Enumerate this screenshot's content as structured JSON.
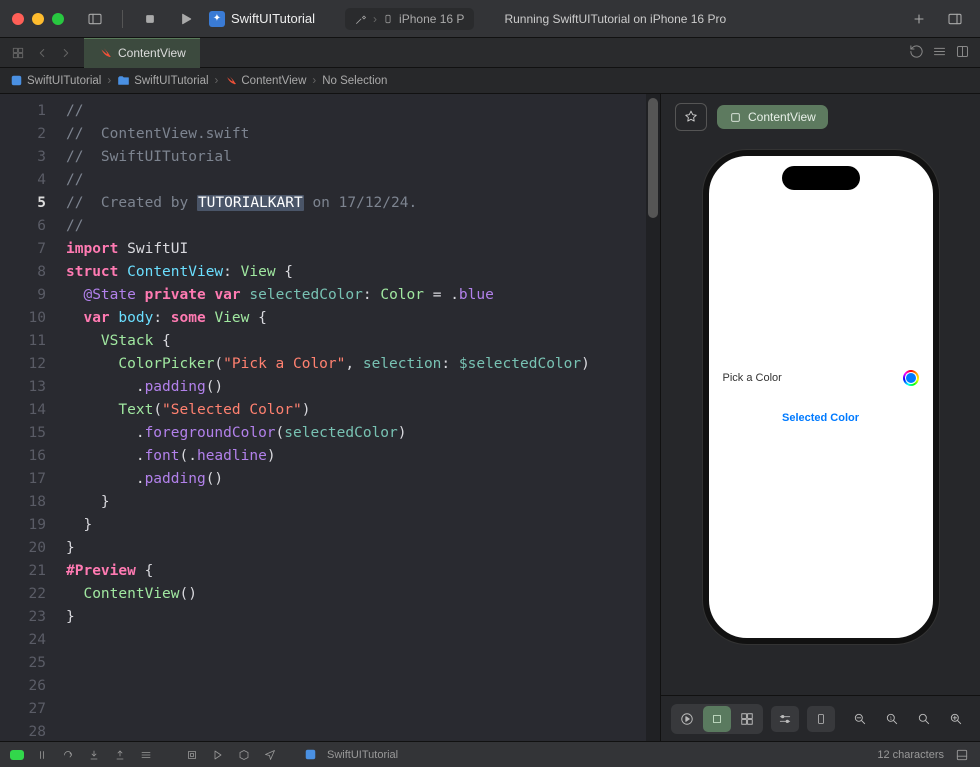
{
  "titlebar": {
    "project_name": "SwiftUITutorial",
    "device": "iPhone 16 P",
    "status": "Running SwiftUITutorial on iPhone 16 Pro"
  },
  "tab": {
    "filename": "ContentView"
  },
  "breadcrumb": {
    "project": "SwiftUITutorial",
    "folder": "SwiftUITutorial",
    "file": "ContentView",
    "selection": "No Selection"
  },
  "code": {
    "lines": [
      {
        "n": 1,
        "seg": [
          [
            "//",
            "comment"
          ]
        ]
      },
      {
        "n": 2,
        "seg": [
          [
            "//  ContentView.swift",
            "comment"
          ]
        ]
      },
      {
        "n": 3,
        "seg": [
          [
            "//  SwiftUITutorial",
            "comment"
          ]
        ]
      },
      {
        "n": 4,
        "seg": [
          [
            "//",
            "comment"
          ]
        ]
      },
      {
        "n": 5,
        "seg": [
          [
            "//  Created by ",
            "comment"
          ],
          [
            "TUTORIALKART",
            "sel"
          ],
          [
            " on 17/12/24.",
            "comment"
          ]
        ],
        "current": true
      },
      {
        "n": 6,
        "seg": [
          [
            "//",
            "comment"
          ]
        ]
      },
      {
        "n": 7,
        "seg": [
          [
            "",
            ""
          ]
        ]
      },
      {
        "n": 8,
        "seg": [
          [
            "import",
            "kw"
          ],
          [
            " ",
            ""
          ],
          [
            "SwiftUI",
            "plain"
          ]
        ]
      },
      {
        "n": 9,
        "seg": [
          [
            "",
            ""
          ]
        ]
      },
      {
        "n": 10,
        "seg": [
          [
            "struct",
            "kw"
          ],
          [
            " ",
            ""
          ],
          [
            "ContentView",
            "decl"
          ],
          [
            ":",
            ""
          ],
          [
            " ",
            ""
          ],
          [
            "View",
            "type2"
          ],
          [
            " {",
            ""
          ]
        ]
      },
      {
        "n": 11,
        "seg": [
          [
            "  ",
            ""
          ],
          [
            "@State",
            "func"
          ],
          [
            " ",
            ""
          ],
          [
            "private",
            "kw"
          ],
          [
            " ",
            ""
          ],
          [
            "var",
            "kw"
          ],
          [
            " ",
            ""
          ],
          [
            "selectedColor",
            "prop"
          ],
          [
            ":",
            ""
          ],
          [
            " ",
            ""
          ],
          [
            "Color",
            "type2"
          ],
          [
            " = .",
            ""
          ],
          [
            "blue",
            "func"
          ]
        ]
      },
      {
        "n": 12,
        "seg": [
          [
            "",
            ""
          ]
        ]
      },
      {
        "n": 13,
        "seg": [
          [
            "  ",
            ""
          ],
          [
            "var",
            "kw"
          ],
          [
            " ",
            ""
          ],
          [
            "body",
            "decl"
          ],
          [
            ":",
            ""
          ],
          [
            " ",
            ""
          ],
          [
            "some",
            "kw"
          ],
          [
            " ",
            ""
          ],
          [
            "View",
            "type2"
          ],
          [
            " {",
            ""
          ]
        ]
      },
      {
        "n": 14,
        "seg": [
          [
            "    ",
            ""
          ],
          [
            "VStack",
            "type2"
          ],
          [
            " {",
            ""
          ]
        ]
      },
      {
        "n": 15,
        "seg": [
          [
            "      ",
            ""
          ],
          [
            "ColorPicker",
            "type2"
          ],
          [
            "(",
            ""
          ],
          [
            "\"Pick a Color\"",
            "str"
          ],
          [
            ", ",
            ""
          ],
          [
            "selection",
            "prop"
          ],
          [
            ": ",
            ""
          ],
          [
            "$selectedColor",
            "prop"
          ],
          [
            ")",
            ""
          ]
        ]
      },
      {
        "n": 16,
        "seg": [
          [
            "        .",
            ""
          ],
          [
            "padding",
            "func"
          ],
          [
            "()",
            ""
          ]
        ]
      },
      {
        "n": 17,
        "seg": [
          [
            "",
            ""
          ]
        ]
      },
      {
        "n": 18,
        "seg": [
          [
            "      ",
            ""
          ],
          [
            "Text",
            "type2"
          ],
          [
            "(",
            ""
          ],
          [
            "\"Selected Color\"",
            "str"
          ],
          [
            ")",
            ""
          ]
        ]
      },
      {
        "n": 19,
        "seg": [
          [
            "        .",
            ""
          ],
          [
            "foregroundColor",
            "func"
          ],
          [
            "(",
            ""
          ],
          [
            "selectedColor",
            "prop"
          ],
          [
            ")",
            ""
          ]
        ]
      },
      {
        "n": 20,
        "seg": [
          [
            "        .",
            ""
          ],
          [
            "font",
            "func"
          ],
          [
            "(.",
            ""
          ],
          [
            "headline",
            "func"
          ],
          [
            ")",
            ""
          ]
        ]
      },
      {
        "n": 21,
        "seg": [
          [
            "        .",
            ""
          ],
          [
            "padding",
            "func"
          ],
          [
            "()",
            ""
          ]
        ]
      },
      {
        "n": 22,
        "seg": [
          [
            "    }",
            ""
          ]
        ]
      },
      {
        "n": 23,
        "seg": [
          [
            "  }",
            ""
          ]
        ]
      },
      {
        "n": 24,
        "seg": [
          [
            "}",
            ""
          ]
        ]
      },
      {
        "n": 25,
        "seg": [
          [
            "",
            ""
          ]
        ]
      },
      {
        "n": 26,
        "seg": [
          [
            "#Preview",
            "kw"
          ],
          [
            " {",
            ""
          ]
        ]
      },
      {
        "n": 27,
        "seg": [
          [
            "  ",
            ""
          ],
          [
            "ContentView",
            "type2"
          ],
          [
            "()",
            ""
          ]
        ]
      },
      {
        "n": 28,
        "seg": [
          [
            "}",
            ""
          ]
        ]
      }
    ]
  },
  "preview": {
    "badge": "ContentView",
    "picker_label": "Pick a Color",
    "selected_text": "Selected Color"
  },
  "statusbar": {
    "project": "SwiftUITutorial",
    "chars": "12 characters"
  }
}
